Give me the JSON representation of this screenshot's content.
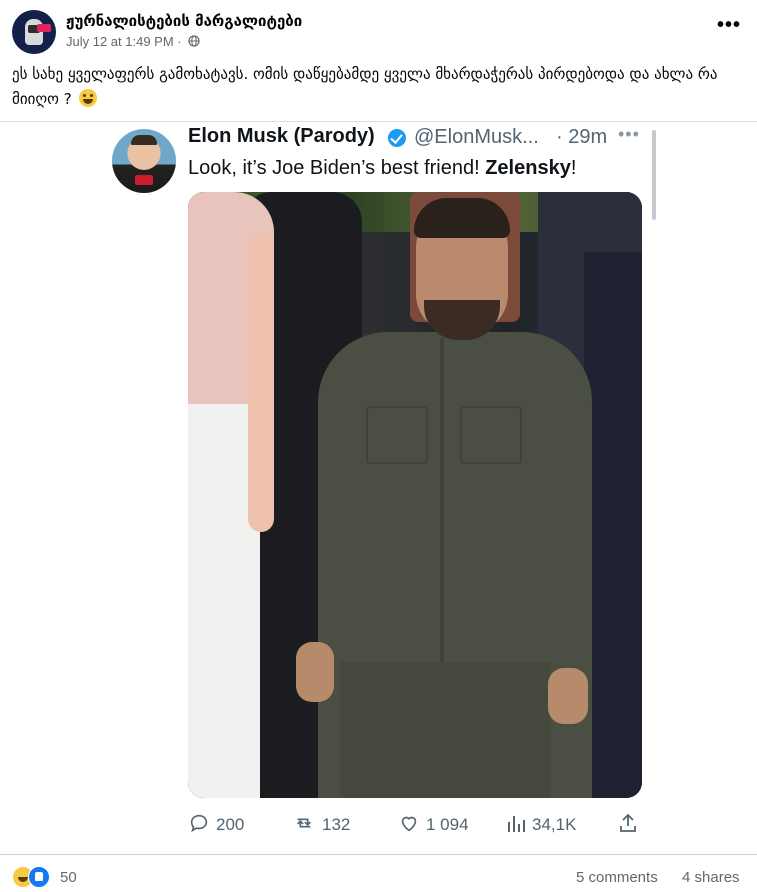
{
  "post": {
    "page_name": "ჟურნალისტების მარგალიტები",
    "timestamp": "July 12 at 1:49 PM",
    "separator": "·",
    "privacy_icon": "globe-icon",
    "more_label": "•••",
    "text": "ეს სახე ყველაფერს გამოხატავს. ომის დაწყებამდე ყველა მხარდაჭერას პირდებოდა და ახლა რა მიიღო ? ",
    "emoji": "grinning-face-emoji"
  },
  "tweet": {
    "name": "Elon Musk (Parody)",
    "handle": "@ElonMusk...",
    "time": "· 29m",
    "more_label": "•••",
    "text_plain": "Look, it’s Joe Biden’s best friend! ",
    "text_bold": "Zelensky",
    "text_end": "!",
    "actions": {
      "replies": "200",
      "retweets": "132",
      "likes": "1 094",
      "views": "34,1K"
    }
  },
  "footer": {
    "reaction_count": "50",
    "comments": "5 comments",
    "shares": "4 shares"
  },
  "colors": {
    "twitter_blue": "#1d9bf0",
    "facebook_blue": "#1877f2",
    "muted_text": "#65676b"
  }
}
